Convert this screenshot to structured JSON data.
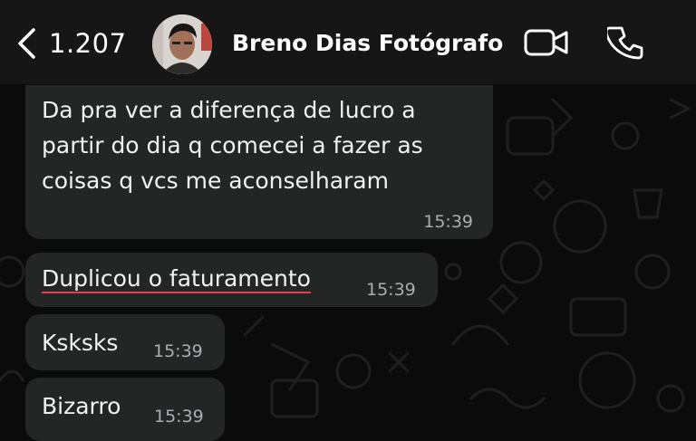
{
  "header": {
    "back_count": "1.207",
    "contact_name": "Breno Dias Fotógrafo",
    "icons": [
      "chevron-left-icon",
      "avatar",
      "video-call-icon",
      "phone-icon"
    ]
  },
  "messages": [
    {
      "text": "Da pra ver a diferença de lucro a\npartir do dia q comecei a fazer as\ncoisas q vcs me aconselharam",
      "time": "15:39"
    },
    {
      "text": "Duplicou o faturamento",
      "time": "15:39"
    },
    {
      "text": "Ksksks",
      "time": "15:39"
    },
    {
      "text": "Bizarro",
      "time": "15:39"
    }
  ],
  "colors": {
    "background": "#0b0b0b",
    "header": "#161616",
    "bubble": "#242626",
    "timestamp": "#a9aeb1",
    "spellcheck_underline": "#e0414b"
  }
}
